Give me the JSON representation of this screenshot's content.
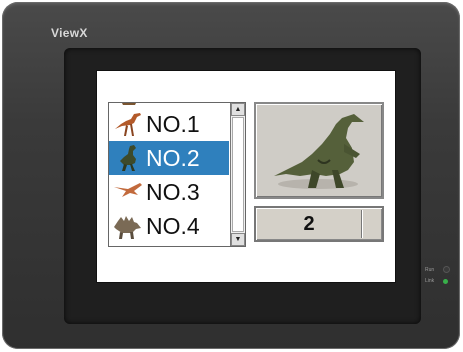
{
  "device": {
    "brand": "ViewX",
    "leds": [
      {
        "label": "Run",
        "color": "#3a3a3a"
      },
      {
        "label": "Link",
        "color": "#38b04a"
      }
    ]
  },
  "listbox": {
    "items": [
      {
        "label": "NO.1",
        "icon": "dinosaur-walking-icon",
        "selected": false
      },
      {
        "label": "NO.2",
        "icon": "dinosaur-standing-icon",
        "selected": true
      },
      {
        "label": "NO.3",
        "icon": "pterosaur-flying-icon",
        "selected": false
      },
      {
        "label": "NO.4",
        "icon": "stegosaur-icon",
        "selected": false
      }
    ],
    "selected_color": "#2f80bd"
  },
  "preview": {
    "image_icon": "parasaurolophus-image-icon"
  },
  "number_display": {
    "value": "2"
  }
}
